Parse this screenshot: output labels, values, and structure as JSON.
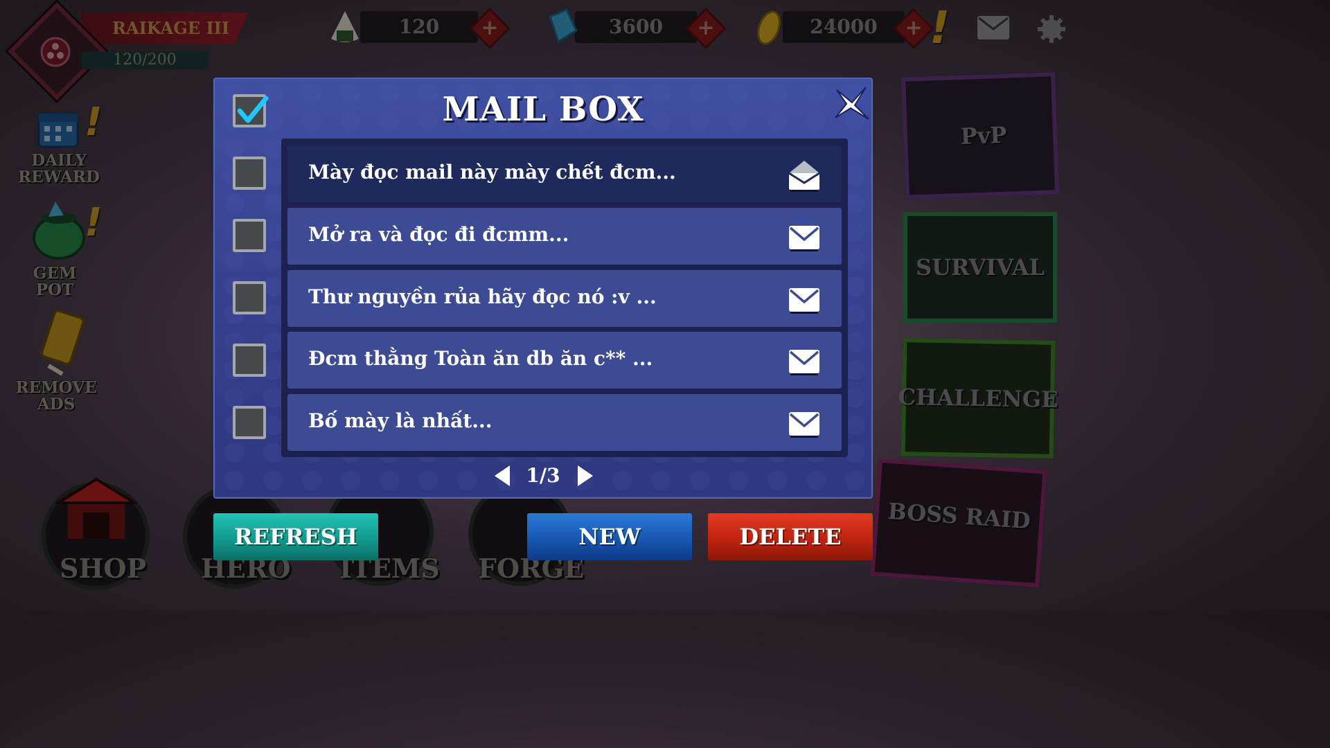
{
  "hud": {
    "rank_title": "RAIKAGE III",
    "rank_xp": "120/200",
    "currencies": [
      {
        "name": "stamina",
        "icon": "rice-ball-icon",
        "value": "120"
      },
      {
        "name": "gems",
        "icon": "gem-icon",
        "value": "3600"
      },
      {
        "name": "gold",
        "icon": "gold-coin-icon",
        "value": "24000"
      }
    ],
    "plus_label": "+"
  },
  "side_menu": [
    {
      "id": "daily-reward",
      "line1": "DAILY",
      "line2": "REWARD",
      "icon": "calendar-icon"
    },
    {
      "id": "gem-pot",
      "line1": "GEM",
      "line2": "POT",
      "icon": "gem-pot-icon"
    },
    {
      "id": "remove-ads",
      "line1": "REMOVE",
      "line2": "ADS",
      "icon": "ticket-icon"
    }
  ],
  "modes": [
    {
      "id": "pvp",
      "label": "PvP",
      "color": "#6b3a8a"
    },
    {
      "id": "survival",
      "label": "SURVIVAL",
      "color": "#2a8a4a"
    },
    {
      "id": "challenge",
      "label": "CHALLENGE",
      "color": "#3f8a2a"
    },
    {
      "id": "boss-raid",
      "label": "BOSS RAID",
      "color": "#8a2a6a"
    }
  ],
  "bottom_nav": [
    {
      "id": "shop",
      "label": "SHOP"
    },
    {
      "id": "hero",
      "label": "HERO"
    },
    {
      "id": "items",
      "label": "ITEMS"
    },
    {
      "id": "forge",
      "label": "FORGE"
    }
  ],
  "mailbox": {
    "title": "MAIL BOX",
    "select_all_checked": true,
    "mails": [
      {
        "subject": "Mày đọc mail này mày chết đcm...",
        "read": true
      },
      {
        "subject": "Mở ra và đọc đi đcmm...",
        "read": false
      },
      {
        "subject": "Thư nguyền rủa hãy đọc nó :v ...",
        "read": false
      },
      {
        "subject": "Đcm thằng Toàn ăn db ăn c** ...",
        "read": false
      },
      {
        "subject": "Bố mày là nhất...",
        "read": false
      }
    ],
    "page": "1/3",
    "buttons": {
      "refresh": "REFRESH",
      "new": "NEW",
      "delete": "DELETE"
    }
  }
}
